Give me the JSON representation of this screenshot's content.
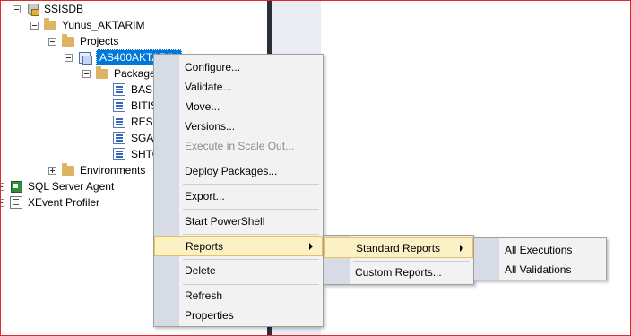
{
  "tree": {
    "ssisdb": "SSISDB",
    "folder": "Yunus_AKTARIM",
    "projects": "Projects",
    "project": "AS400AKTARIM",
    "packages": "Package",
    "package_items": [
      "BASL",
      "BITIS",
      "REST",
      "SGAI",
      "SHTO"
    ],
    "environments": "Environments",
    "sql_agent": "SQL Server Agent",
    "xevent": "XEvent Profiler"
  },
  "context_menu": {
    "configure": "Configure...",
    "validate": "Validate...",
    "move": "Move...",
    "versions": "Versions...",
    "execute_scale_out": "Execute in Scale Out...",
    "deploy_packages": "Deploy Packages...",
    "export": "Export...",
    "start_powershell": "Start PowerShell",
    "reports": "Reports",
    "delete": "Delete",
    "refresh": "Refresh",
    "properties": "Properties"
  },
  "reports_menu": {
    "standard_reports": "Standard Reports",
    "custom_reports": "Custom Reports..."
  },
  "standard_reports_menu": {
    "all_executions": "All Executions",
    "all_validations": "All Validations"
  },
  "colors": {
    "highlight_bg": "#fcf0c5",
    "selection": "#0078d7",
    "menu_gutter": "#d7dbe6"
  }
}
